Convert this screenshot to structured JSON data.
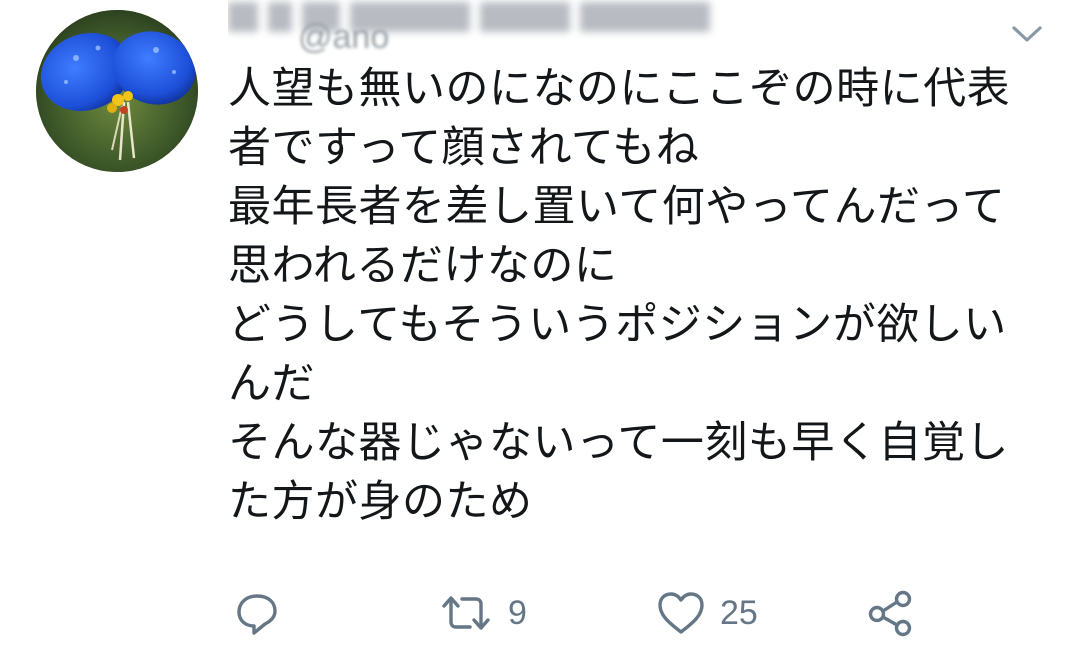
{
  "author": {
    "display_name": "████",
    "handle": "@ano",
    "avatar_icon": "blue-flower-avatar"
  },
  "menu": {
    "icon": "chevron-down-icon"
  },
  "tweet": {
    "lines": [
      "人望も無いのになのにここぞの時に代表",
      "者ですって顔されてもね",
      "最年長者を差し置いて何やってんだって",
      "思われるだけなのに",
      "どうしてもそういうポジションが欲しい",
      "んだ",
      "そんな器じゃないって一刻も早く自覚し",
      "た方が身のため"
    ]
  },
  "actions": {
    "reply": {
      "icon": "reply-icon",
      "count": ""
    },
    "retweet": {
      "icon": "retweet-icon",
      "count": "9"
    },
    "like": {
      "icon": "heart-icon",
      "count": "25"
    },
    "share": {
      "icon": "share-icon",
      "count": ""
    }
  },
  "colors": {
    "text": "#14171a",
    "muted": "#657786",
    "background": "#ffffff"
  }
}
